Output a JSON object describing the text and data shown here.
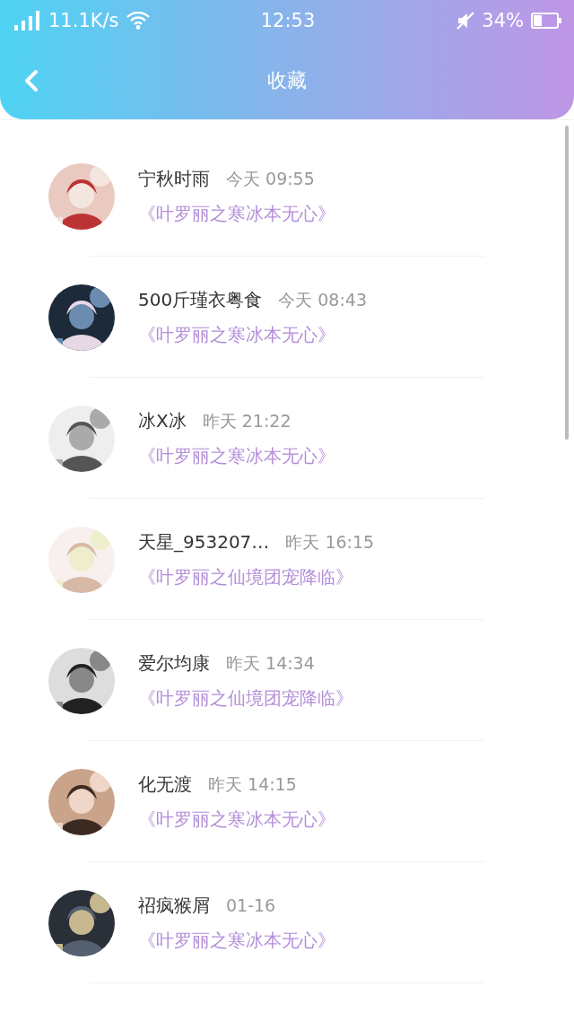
{
  "status_bar": {
    "speed": "11.1K/s",
    "time": "12:53",
    "battery": "34%"
  },
  "header": {
    "title": "收藏"
  },
  "items": [
    {
      "name": "宁秋时雨",
      "time": "今天 09:55",
      "book": "《叶罗丽之寒冰本无心》"
    },
    {
      "name": "500斤瑾衣粤食",
      "time": "今天 08:43",
      "book": "《叶罗丽之寒冰本无心》"
    },
    {
      "name": "冰X冰",
      "time": "昨天 21:22",
      "book": "《叶罗丽之寒冰本无心》"
    },
    {
      "name": "天星_953207…",
      "time": "昨天 16:15",
      "book": "《叶罗丽之仙境团宠降临》"
    },
    {
      "name": "爱尔均康",
      "time": "昨天 14:34",
      "book": "《叶罗丽之仙境团宠降临》"
    },
    {
      "name": "化无渡",
      "time": "昨天 14:15",
      "book": "《叶罗丽之寒冰本无心》"
    },
    {
      "name": "祒疯猴屑",
      "time": "01-16",
      "book": "《叶罗丽之寒冰本无心》"
    }
  ]
}
